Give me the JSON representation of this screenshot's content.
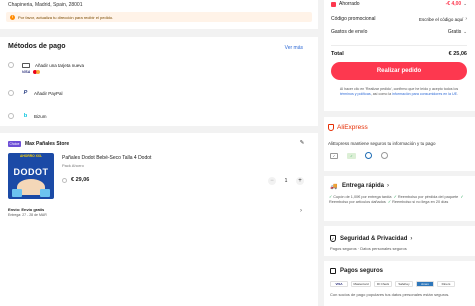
{
  "address": {
    "line": "Chapineria, Madrid, Spain, 28001",
    "warning": "Por favor, actualiza tu dirección para recibir el pedido."
  },
  "payment": {
    "title": "Métodos de pago",
    "see_more": "Ver más",
    "methods": [
      {
        "label": "Añadir una tarjeta nueva",
        "icon": "credit-card-icon"
      },
      {
        "label": "Añadir PayPal",
        "icon": "paypal-icon"
      },
      {
        "label": "Bizum",
        "icon": "bizum-icon"
      }
    ]
  },
  "store": {
    "badge": "Choice",
    "name": "Max Pañales Store",
    "product": {
      "title": "Pañales Dodot Bebé-Seco Talla 4 Dodot",
      "variant": "Pack Ahorro",
      "price": "€ 29,06",
      "quantity": "1",
      "image_caption": "AHORRO XXL",
      "image_brand": "DODOT"
    },
    "shipping": "Envío: Envío gratis",
    "delivery": "Entrega: 27 - 28 de MAR"
  },
  "summary": {
    "savings_label": "Ahorrado",
    "savings_value": "-€ 4,00",
    "promo_label": "Código promocional",
    "promo_value": "Escribe el código aquí",
    "shipping_label": "Gastos de envío",
    "shipping_value": "Gratis",
    "total_label": "Total",
    "total_value": "€ 25,06",
    "order_button": "Realizar pedido",
    "legal_1": "Al hacer clic en 'Realizar pedido', confirmo que he leído y acepto todos los ",
    "legal_link_1": "términos y políticas",
    "legal_2": ", así como la ",
    "legal_link_2": "información para consumidores en la UE",
    "legal_3": "."
  },
  "trust": {
    "brand": "AliExpress",
    "subtitle": "AliExpress mantiene seguros tu información y tu pago",
    "fast_delivery": {
      "title": "Entrega rápida",
      "items": [
        "Cupón de 1,00€ por entrega tardía",
        "Reembolso por pérdida del paquete",
        "Reembolso por artículos dañados",
        "Reembolso si no llega en 20 días"
      ]
    },
    "security": {
      "title": "Seguridad & Privacidad",
      "subtitle": "Pagos seguros · Datos personales seguros"
    },
    "payments": {
      "title": "Pagos seguros",
      "logos": [
        "VISA",
        "Mastercard",
        "ID Check",
        "SafeKey",
        "Amex",
        "Diners"
      ],
      "subtitle": "Con socios de pago populares tus datos personales están seguros."
    }
  },
  "colors": {
    "accent": "#fd384f",
    "background": "#f2f2f2",
    "success": "#1ba14f",
    "link": "#2e6ad6"
  }
}
